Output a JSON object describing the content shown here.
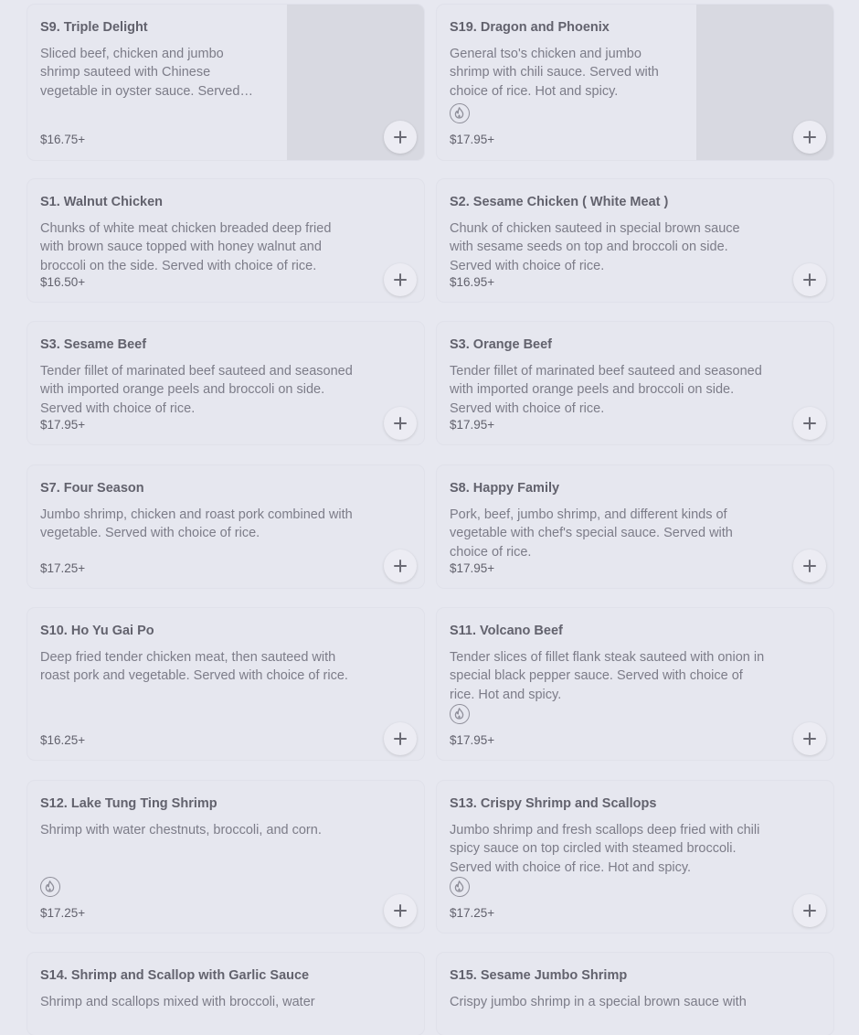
{
  "menu": {
    "items": [
      {
        "name": "S9. Triple Delight",
        "desc": "Sliced beef, chicken and jumbo shrimp sauteed with Chinese vegetable in oyster sauce. Served with choice of rice.",
        "price": "$16.75+",
        "spicy": false,
        "image": true
      },
      {
        "name": "S19. Dragon and Phoenix",
        "desc": "General tso's chicken and jumbo shrimp with chili sauce. Served with choice of rice. Hot and spicy.",
        "price": "$17.95+",
        "spicy": true,
        "image": true
      },
      {
        "name": "S1. Walnut Chicken",
        "desc": "Chunks of white meat chicken breaded deep fried with brown sauce topped with honey walnut and broccoli on the side. Served with choice of rice.",
        "price": "$16.50+",
        "spicy": false,
        "image": false
      },
      {
        "name": "S2. Sesame Chicken ( White Meat )",
        "desc": "Chunk of chicken sauteed in special brown sauce with sesame seeds on top and broccoli on side. Served with choice of rice.",
        "price": "$16.95+",
        "spicy": false,
        "image": false
      },
      {
        "name": "S3. Sesame Beef",
        "desc": "Tender fillet of marinated beef sauteed and seasoned with imported orange peels and broccoli on side. Served with choice of rice.",
        "price": "$17.95+",
        "spicy": false,
        "image": false
      },
      {
        "name": "S3. Orange Beef",
        "desc": "Tender fillet of marinated beef sauteed and seasoned with imported orange peels and broccoli on side. Served with choice of rice.",
        "price": "$17.95+",
        "spicy": false,
        "image": false
      },
      {
        "name": "S7. Four Season",
        "desc": "Jumbo shrimp, chicken and roast pork combined with vegetable. Served with choice of rice.",
        "price": "$17.25+",
        "spicy": false,
        "image": false
      },
      {
        "name": "S8. Happy Family",
        "desc": "Pork, beef, jumbo shrimp, and different kinds of vegetable with chef's special sauce. Served with choice of rice.",
        "price": "$17.95+",
        "spicy": false,
        "image": false
      },
      {
        "name": "S10. Ho Yu Gai Po",
        "desc": "Deep fried tender chicken meat, then sauteed with roast pork and vegetable. Served with choice of rice.",
        "price": "$16.25+",
        "spicy": false,
        "image": false
      },
      {
        "name": "S11. Volcano Beef",
        "desc": "Tender slices of fillet flank steak sauteed with onion in special black pepper sauce. Served with choice of rice. Hot and spicy.",
        "price": "$17.95+",
        "spicy": true,
        "image": false
      },
      {
        "name": "S12. Lake Tung Ting Shrimp",
        "desc": "Shrimp with water chestnuts, broccoli, and corn.",
        "price": "$17.25+",
        "spicy": true,
        "image": false
      },
      {
        "name": "S13. Crispy Shrimp and Scallops",
        "desc": "Jumbo shrimp and fresh scallops deep fried with chili spicy sauce on top circled with steamed broccoli. Served with choice of rice. Hot and spicy.",
        "price": "$17.25+",
        "spicy": true,
        "image": false
      },
      {
        "name": "S14. Shrimp and Scallop with Garlic Sauce",
        "desc": "Shrimp and scallops mixed with broccoli, water",
        "price": "",
        "spicy": false,
        "image": false
      },
      {
        "name": "S15. Sesame Jumbo Shrimp",
        "desc": "Crispy jumbo shrimp in a special brown sauce with",
        "price": "",
        "spicy": false,
        "image": false
      }
    ]
  }
}
